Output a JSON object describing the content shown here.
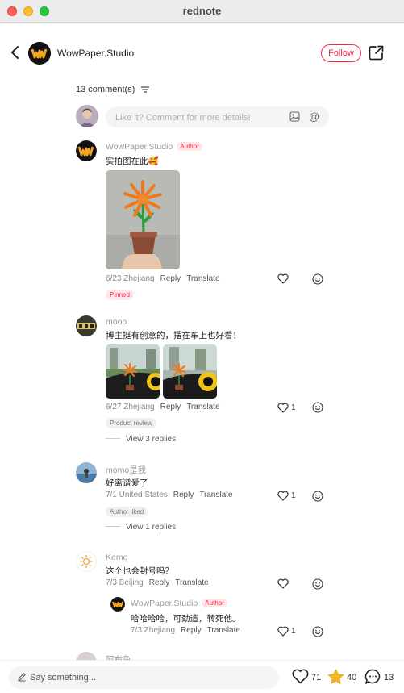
{
  "window": {
    "title": "rednote"
  },
  "header": {
    "author_name": "WowPaper.Studio",
    "follow_label": "Follow"
  },
  "comments_section": {
    "count_label": "13 comment(s)"
  },
  "composer": {
    "placeholder": "Like it? Comment for more details!"
  },
  "comments": [
    {
      "user": "WowPaper.Studio",
      "author_tag": "Author",
      "text": "实拍图在此🥰",
      "date_loc": "6/23 Zhejiang",
      "reply": "Reply",
      "translate": "Translate",
      "chip": "Pinned",
      "likes": "",
      "image_desc": "orange paper flower in pot"
    },
    {
      "user": "mooo",
      "text": "博主挺有创意的，摆在车上也好看！",
      "date_loc": "6/27 Zhejiang",
      "reply": "Reply",
      "translate": "Translate",
      "chip": "Product review",
      "likes": "1",
      "view_replies": "View 3 replies"
    },
    {
      "user": "momo是我",
      "text": "好离谱爱了",
      "date_loc": "7/1 United States",
      "reply": "Reply",
      "translate": "Translate",
      "chip": "Author liked",
      "likes": "1",
      "view_replies": "View 1 replies"
    },
    {
      "user": "Kemo",
      "text": "这个也会封号吗？",
      "date_loc": "7/3 Beijing",
      "reply": "Reply",
      "translate": "Translate",
      "likes": "",
      "reply_item": {
        "user": "WowPaper.Studio",
        "author_tag": "Author",
        "text": "哈哈哈哈，可劲造，转死他。",
        "date_loc": "7/3 Zhejiang",
        "reply": "Reply",
        "translate": "Translate",
        "likes": "1"
      }
    },
    {
      "user": "阿布鱼"
    }
  ],
  "bottom_bar": {
    "placeholder": "Say something...",
    "likes": "71",
    "collects": "40",
    "comments": "13"
  },
  "colors": {
    "accent": "#ff2442",
    "collect_star": "#f5b722"
  }
}
